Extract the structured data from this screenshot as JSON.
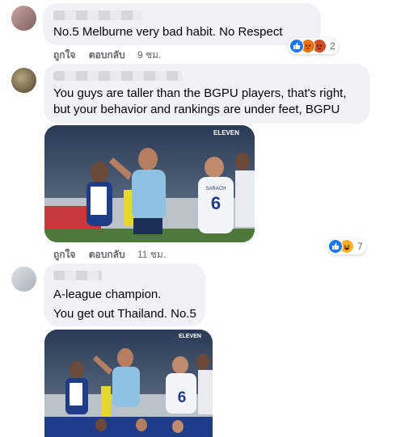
{
  "comments": [
    {
      "text": [
        "No.5 Melburne very bad habit. No Respect"
      ],
      "actions": {
        "like": "ถูกใจ",
        "reply": "ตอบกลับ",
        "time": "9 ชม."
      },
      "reactions": {
        "icons": [
          "like-icon",
          "angry-icon",
          "angry-icon"
        ],
        "count": "2"
      }
    },
    {
      "text": [
        "You guys are taller than the BGPU players, that's right,",
        "but your behavior and rankings are under feet, BGPU"
      ],
      "photo": {
        "brand": "ELEVEN",
        "jersey_number": "6",
        "jersey_name": "SARACH"
      },
      "actions": {
        "like": "ถูกใจ",
        "reply": "ตอบกลับ",
        "time": "11 ชม."
      },
      "reactions": {
        "icons": [
          "like-icon",
          "haha-icon"
        ],
        "count": "7"
      }
    },
    {
      "text": [
        "A-league champion.",
        "You get out Thailand. No.5"
      ],
      "photo": {
        "brand": "ELEVEN",
        "jersey_number": "6"
      }
    }
  ],
  "colors": {
    "bubble": "#f0f2f5",
    "like_blue": "#1877f2",
    "angry_orange": "#e9710f",
    "haha_yellow": "#f7b125",
    "meta_grey": "#65676b",
    "home_kit_blue": "#1f3c88",
    "away_kit_skyblue": "#8fc1e3"
  }
}
